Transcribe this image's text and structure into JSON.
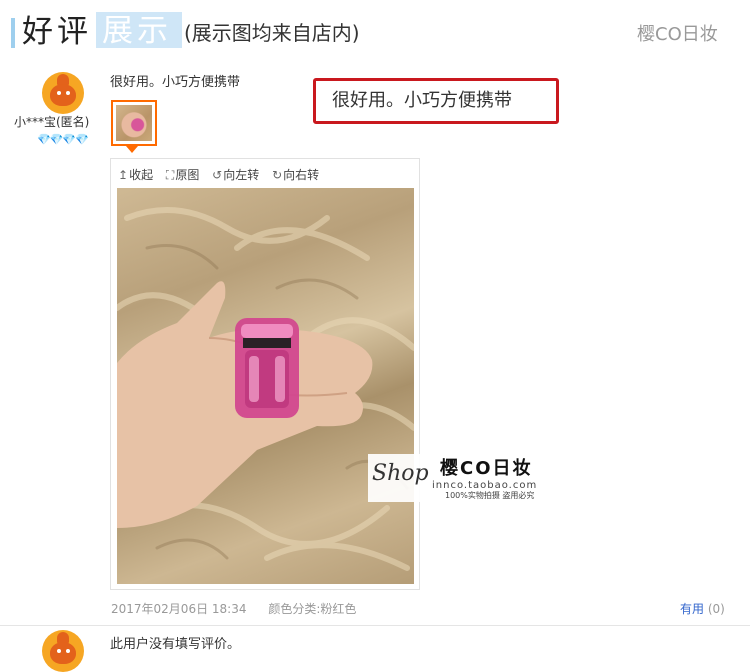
{
  "header": {
    "title_part1": "好评",
    "title_part2": "展示",
    "subtitle": "(展示图均来自店内)",
    "store_name": "樱CO日妆"
  },
  "reviews": [
    {
      "username": "小***宝(匿名)",
      "rank_gems": "💎💎💎💎",
      "text": "很好用。小巧方便携带",
      "callout": "很好用。小巧方便携带",
      "toolbar": {
        "collapse": "收起",
        "original": "原图",
        "rotate_left": "向左转",
        "rotate_right": "向右转"
      },
      "watermark": {
        "shop": "Shop",
        "brand": "樱CO日妆",
        "url": "innco.taobao.com",
        "note": "100%实物拍摄 盗用必究"
      },
      "date": "2017年02月06日 18:34",
      "color_label": "颜色分类:粉红色",
      "useful_label": "有用",
      "useful_count": "(0)"
    },
    {
      "text": "此用户没有填写评价。"
    }
  ],
  "colors": {
    "accent_blue": "#9ecfee",
    "callout_red": "#c9181e",
    "thumb_orange": "#ff6a00",
    "link_blue": "#3366cc"
  },
  "icons": {
    "collapse": "arrow-up-icon",
    "original": "expand-icon",
    "rotate_left": "rotate-left-icon",
    "rotate_right": "rotate-right-icon"
  }
}
